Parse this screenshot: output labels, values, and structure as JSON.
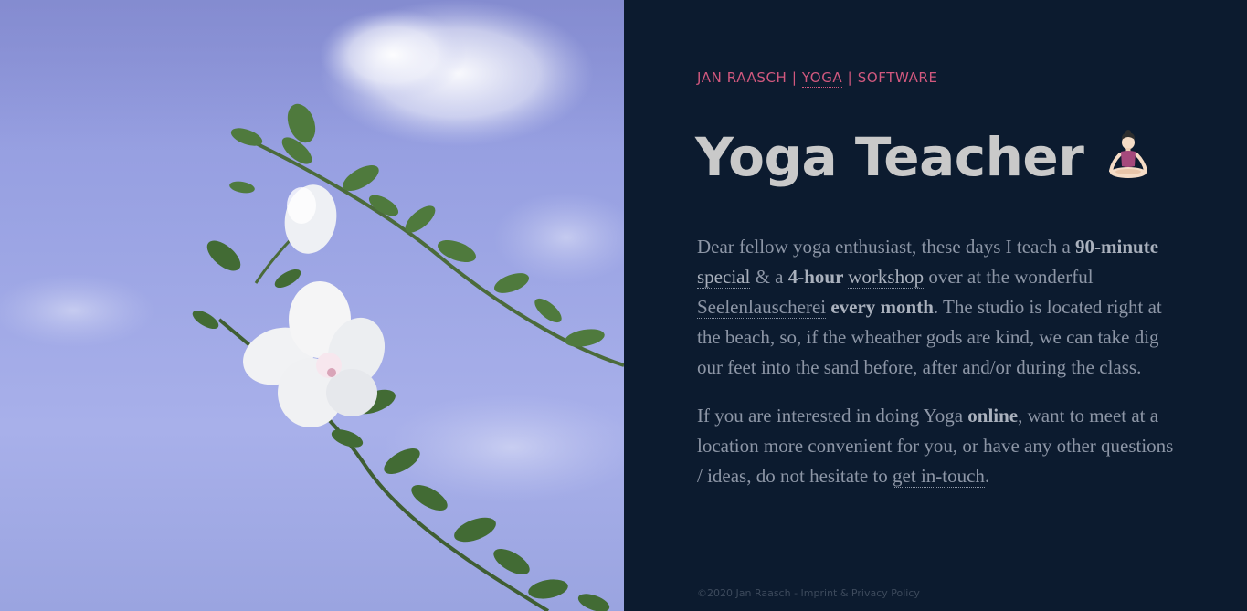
{
  "brand": {
    "name": "JAN RAASCH",
    "separator": "|",
    "yoga": "YOGA",
    "software": "SOFTWARE"
  },
  "title": {
    "text": "Yoga Teacher",
    "emoji_icon": "woman-in-lotus-position-icon"
  },
  "paragraph1": {
    "t1": "Dear fellow yoga enthusiast, these days I teach a ",
    "b1": "90-minute ",
    "link_special": "special",
    "t2": " & a ",
    "b2": "4-hour ",
    "link_workshop": "workshop",
    "t3": " over at the wonderful ",
    "link_studio": "Seelenlauscherei",
    "b3": " every month",
    "t4": ". The studio is located right at the beach, so, if the wheather gods are kind, we can take dig our feet into the sand before, after and/or during the class."
  },
  "paragraph2": {
    "t1": "If you are interested in doing Yoga ",
    "b1": "online",
    "t2": ", want to meet at a location more convenient for you, or have any other questions / ideas, do not hesitate to ",
    "link_contact": "get in-touch",
    "t3": "."
  },
  "footer": {
    "copyright": "©2020 Jan Raasch - ",
    "imprint_link": "Imprint & Privacy Policy"
  },
  "colors": {
    "background": "#0c1b2f",
    "accent": "#d1587e",
    "title": "#c9c9c9",
    "body": "#8d96a6"
  }
}
